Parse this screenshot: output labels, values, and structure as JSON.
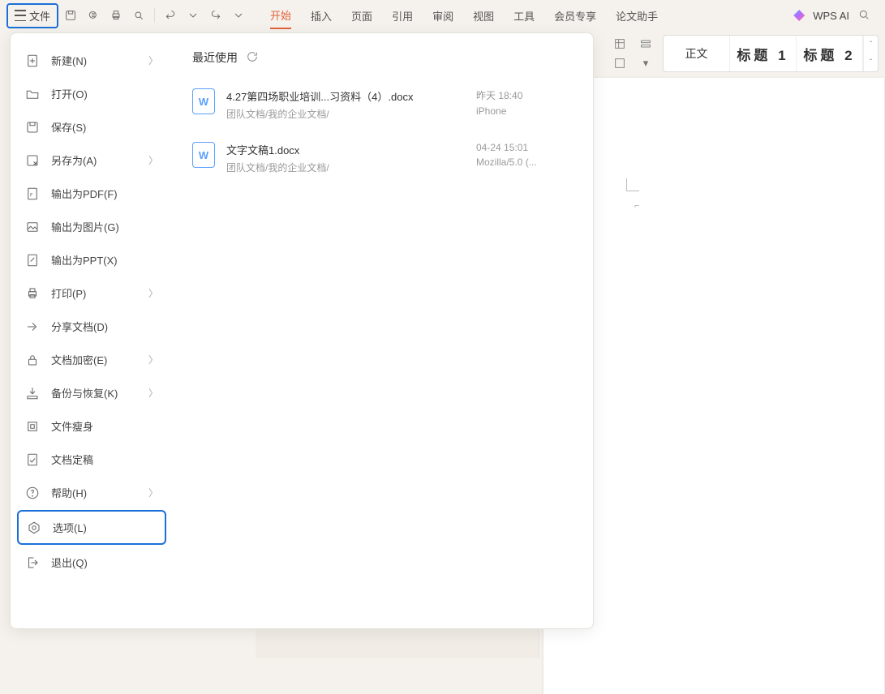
{
  "toolbar": {
    "file_label": "文件"
  },
  "tabs": [
    "开始",
    "插入",
    "页面",
    "引用",
    "审阅",
    "视图",
    "工具",
    "会员专享",
    "论文助手"
  ],
  "active_tab_index": 0,
  "top_right": {
    "ai_label": "WPS AI"
  },
  "styles": {
    "items": [
      "正文",
      "标题 1",
      "标题 2"
    ]
  },
  "file_menu": {
    "items": [
      {
        "label": "新建(N)",
        "icon": "new",
        "sub": true
      },
      {
        "label": "打开(O)",
        "icon": "open",
        "sub": false
      },
      {
        "label": "保存(S)",
        "icon": "save",
        "sub": false
      },
      {
        "label": "另存为(A)",
        "icon": "saveas",
        "sub": true
      },
      {
        "label": "输出为PDF(F)",
        "icon": "pdf",
        "sub": false
      },
      {
        "label": "输出为图片(G)",
        "icon": "img",
        "sub": false
      },
      {
        "label": "输出为PPT(X)",
        "icon": "ppt",
        "sub": false
      },
      {
        "label": "打印(P)",
        "icon": "print",
        "sub": true
      },
      {
        "label": "分享文档(D)",
        "icon": "share",
        "sub": false
      },
      {
        "label": "文档加密(E)",
        "icon": "lock",
        "sub": true
      },
      {
        "label": "备份与恢复(K)",
        "icon": "backup",
        "sub": true
      },
      {
        "label": "文件瘦身",
        "icon": "slim",
        "sub": false
      },
      {
        "label": "文档定稿",
        "icon": "final",
        "sub": false
      },
      {
        "label": "帮助(H)",
        "icon": "help",
        "sub": true
      },
      {
        "label": "选项(L)",
        "icon": "options",
        "sub": false,
        "highlight": true
      },
      {
        "label": "退出(Q)",
        "icon": "exit",
        "sub": false
      }
    ]
  },
  "recent": {
    "title": "最近使用",
    "items": [
      {
        "name": "4.27第四场职业培训...习资料（4）.docx",
        "path": "团队文档/我的企业文档/",
        "time": "昨天 18:40",
        "origin": "iPhone"
      },
      {
        "name": "文字文稿1.docx",
        "path": "团队文档/我的企业文档/",
        "time": "04-24 15:01",
        "origin": "Mozilla/5.0 (..."
      }
    ]
  }
}
